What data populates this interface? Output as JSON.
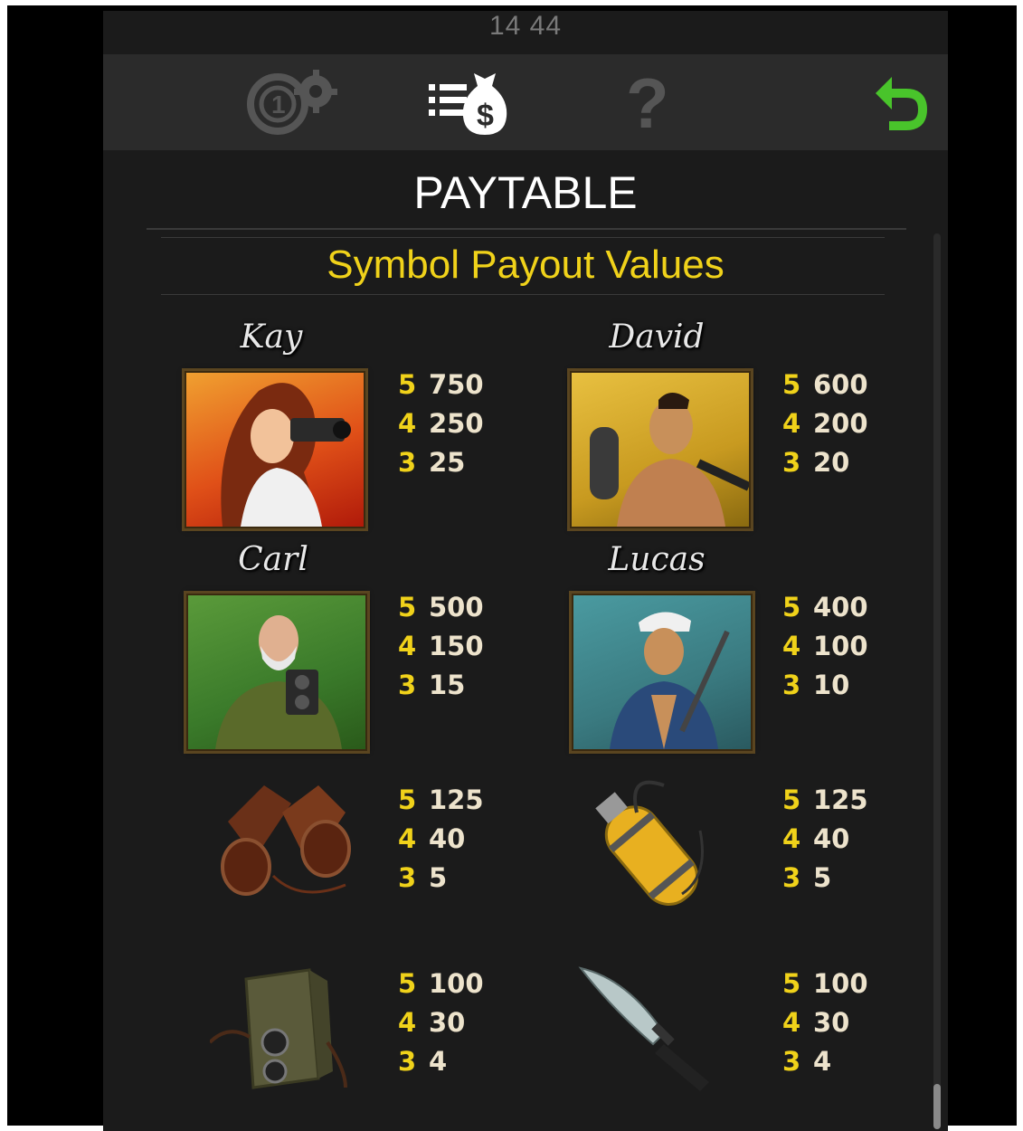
{
  "status_bar": {
    "time": "14 44"
  },
  "toolbar": {
    "bet_settings_icon": "coin-gear-icon",
    "paytable_icon": "money-bag-list-icon",
    "help_icon": "question-icon",
    "back_icon": "return-arrow-icon",
    "active_color": "#ffffff",
    "inactive_color": "#555555",
    "back_color": "#49c42b"
  },
  "header": {
    "title": "PAYTABLE",
    "subtitle": "Symbol Payout Values"
  },
  "colors": {
    "accent": "#f0d21a",
    "background": "#1b1b1b",
    "payout_text": "#ede3cc"
  },
  "symbols": [
    {
      "name": "Kay",
      "icon": "kay-portrait-icon",
      "pays": [
        {
          "count": "5",
          "value": "750"
        },
        {
          "count": "4",
          "value": "250"
        },
        {
          "count": "3",
          "value": "25"
        }
      ]
    },
    {
      "name": "David",
      "icon": "david-portrait-icon",
      "pays": [
        {
          "count": "5",
          "value": "600"
        },
        {
          "count": "4",
          "value": "200"
        },
        {
          "count": "3",
          "value": "20"
        }
      ]
    },
    {
      "name": "Carl",
      "icon": "carl-portrait-icon",
      "pays": [
        {
          "count": "5",
          "value": "500"
        },
        {
          "count": "4",
          "value": "150"
        },
        {
          "count": "3",
          "value": "15"
        }
      ]
    },
    {
      "name": "Lucas",
      "icon": "lucas-portrait-icon",
      "pays": [
        {
          "count": "5",
          "value": "400"
        },
        {
          "count": "4",
          "value": "100"
        },
        {
          "count": "3",
          "value": "10"
        }
      ]
    },
    {
      "name": "",
      "icon": "binoculars-icon",
      "pays": [
        {
          "count": "5",
          "value": "125"
        },
        {
          "count": "4",
          "value": "40"
        },
        {
          "count": "3",
          "value": "5"
        }
      ]
    },
    {
      "name": "",
      "icon": "oxygen-tank-icon",
      "pays": [
        {
          "count": "5",
          "value": "125"
        },
        {
          "count": "4",
          "value": "40"
        },
        {
          "count": "3",
          "value": "5"
        }
      ]
    },
    {
      "name": "",
      "icon": "camera-icon",
      "pays": [
        {
          "count": "5",
          "value": "100"
        },
        {
          "count": "4",
          "value": "30"
        },
        {
          "count": "3",
          "value": "4"
        }
      ]
    },
    {
      "name": "",
      "icon": "knife-icon",
      "pays": [
        {
          "count": "5",
          "value": "100"
        },
        {
          "count": "4",
          "value": "30"
        },
        {
          "count": "3",
          "value": "4"
        }
      ]
    }
  ]
}
